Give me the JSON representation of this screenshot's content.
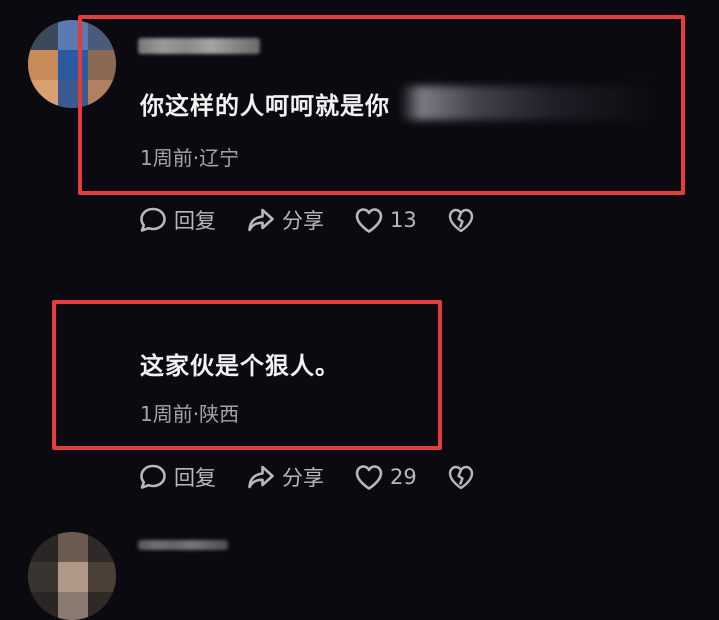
{
  "comments": [
    {
      "text": "你这样的人呵呵就是你",
      "time_location": "1周前·辽宁",
      "actions": {
        "reply_label": "回复",
        "share_label": "分享",
        "like_count": "13"
      }
    },
    {
      "text": "这家伙是个狠人。",
      "time_location": "1周前·陕西",
      "actions": {
        "reply_label": "回复",
        "share_label": "分享",
        "like_count": "29"
      }
    }
  ],
  "colors": {
    "background": "#0b0a10",
    "highlight": "#e43d3d",
    "meta_text": "#a4a4a8"
  },
  "icons": [
    "reply-bubble-icon",
    "share-arrow-icon",
    "heart-icon",
    "broken-heart-icon"
  ]
}
